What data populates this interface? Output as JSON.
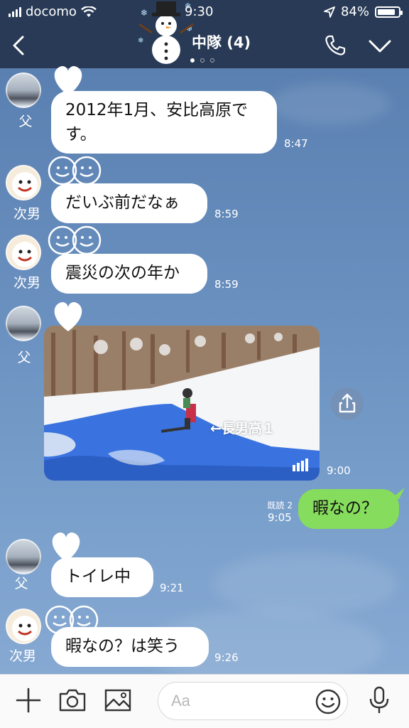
{
  "status": {
    "carrier": "docomo",
    "time": "9:30",
    "battery": "84%",
    "battery_level": 0.84
  },
  "header": {
    "title": "中隊 (4)",
    "page_count": 3,
    "active_page": 0
  },
  "messages": [
    {
      "sender": "父",
      "text_lines": [
        "2012年1月、安比高原で",
        "す。"
      ],
      "time": "8:47"
    },
    {
      "sender": "次男",
      "text": "だいぶ前だなぁ",
      "time": "8:59"
    },
    {
      "sender": "次男",
      "text": "震災の次の年か",
      "time": "8:59"
    },
    {
      "sender": "父",
      "video_caption": "←長男高１",
      "time": "9:00"
    },
    {
      "sender": "me",
      "text": "暇なの？",
      "time": "9:05",
      "read": "既読 2"
    },
    {
      "sender": "父",
      "text": "トイレ中",
      "time": "9:21"
    },
    {
      "sender": "次男",
      "text": "暇なの？は笑う",
      "time": "9:26"
    }
  ],
  "input": {
    "placeholder": "Aa"
  },
  "colors": {
    "header_bg": "#283a55",
    "my_bubble": "#86dc5c",
    "bubble": "#ffffff"
  },
  "icons": [
    "signal-icon",
    "wifi-icon",
    "location-icon",
    "battery-icon",
    "back-chevron-icon",
    "phone-icon",
    "chevron-down-icon",
    "share-icon",
    "video-signal-icon",
    "plus-icon",
    "camera-icon",
    "image-icon",
    "emoji-icon",
    "mic-icon"
  ]
}
